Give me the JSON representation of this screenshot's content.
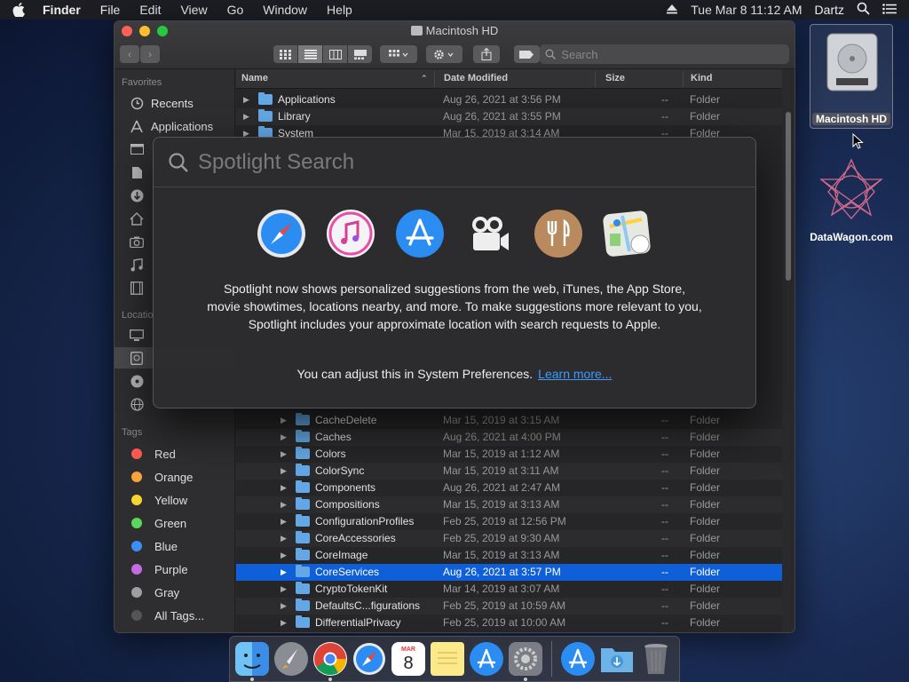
{
  "menubar": {
    "items": [
      "Finder",
      "File",
      "Edit",
      "View",
      "Go",
      "Window",
      "Help"
    ],
    "datetime": "Tue Mar 8  11:12 AM",
    "user": "Dartz"
  },
  "window": {
    "title": "Macintosh HD",
    "search_placeholder": "Search"
  },
  "sidebar": {
    "favorites_heading": "Favorites",
    "favorites": [
      {
        "label": "Recents",
        "icon": "clock-icon"
      },
      {
        "label": "Applications",
        "icon": "applications-icon"
      }
    ],
    "locations_heading": "Locatio",
    "tags_heading": "Tags",
    "tags": [
      {
        "label": "Red",
        "color": "#ff5a52"
      },
      {
        "label": "Orange",
        "color": "#f7a23b"
      },
      {
        "label": "Yellow",
        "color": "#f5d531"
      },
      {
        "label": "Green",
        "color": "#5ad85b"
      },
      {
        "label": "Blue",
        "color": "#3e8ef7"
      },
      {
        "label": "Purple",
        "color": "#c36be0"
      },
      {
        "label": "Gray",
        "color": "#9e9ea2"
      },
      {
        "label": "All Tags...",
        "color": "#555555"
      }
    ]
  },
  "list": {
    "headers": {
      "name": "Name",
      "date": "Date Modified",
      "size": "Size",
      "kind": "Kind"
    },
    "top_rows": [
      {
        "name": "Applications",
        "date": "Aug 26, 2021 at 3:56 PM",
        "size": "--",
        "kind": "Folder"
      },
      {
        "name": "Library",
        "date": "Aug 26, 2021 at 3:55 PM",
        "size": "--",
        "kind": "Folder"
      },
      {
        "name": "System",
        "date": "Mar 15, 2019 at 3:14 AM",
        "size": "--",
        "kind": "Folder"
      }
    ],
    "rows": [
      {
        "name": "CacheDelete",
        "date": "Mar 15, 2019 at 3:15 AM",
        "size": "--",
        "kind": "Folder"
      },
      {
        "name": "Caches",
        "date": "Aug 26, 2021 at 4:00 PM",
        "size": "--",
        "kind": "Folder"
      },
      {
        "name": "Colors",
        "date": "Mar 15, 2019 at 1:12 AM",
        "size": "--",
        "kind": "Folder"
      },
      {
        "name": "ColorSync",
        "date": "Mar 15, 2019 at 3:11 AM",
        "size": "--",
        "kind": "Folder"
      },
      {
        "name": "Components",
        "date": "Aug 26, 2021 at 2:47 AM",
        "size": "--",
        "kind": "Folder"
      },
      {
        "name": "Compositions",
        "date": "Mar 15, 2019 at 3:13 AM",
        "size": "--",
        "kind": "Folder"
      },
      {
        "name": "ConfigurationProfiles",
        "date": "Feb 25, 2019 at 12:56 PM",
        "size": "--",
        "kind": "Folder"
      },
      {
        "name": "CoreAccessories",
        "date": "Feb 25, 2019 at 9:30 AM",
        "size": "--",
        "kind": "Folder"
      },
      {
        "name": "CoreImage",
        "date": "Mar 15, 2019 at 3:13 AM",
        "size": "--",
        "kind": "Folder"
      },
      {
        "name": "CoreServices",
        "date": "Aug 26, 2021 at 3:57 PM",
        "size": "--",
        "kind": "Folder",
        "selected": true
      },
      {
        "name": "CryptoTokenKit",
        "date": "Mar 14, 2019 at 3:07 AM",
        "size": "--",
        "kind": "Folder"
      },
      {
        "name": "DefaultsC...figurations",
        "date": "Feb 25, 2019 at 10:59 AM",
        "size": "--",
        "kind": "Folder"
      },
      {
        "name": "DifferentialPrivacy",
        "date": "Feb 25, 2019 at 10:00 AM",
        "size": "--",
        "kind": "Folder"
      }
    ]
  },
  "spotlight": {
    "placeholder": "Spotlight Search",
    "icons": [
      "safari-icon",
      "itunes-icon",
      "app-store-icon",
      "movie-camera-icon",
      "restaurant-icon",
      "maps-icon"
    ],
    "message": "Spotlight now shows personalized suggestions from the web, iTunes, the App Store, movie showtimes, locations nearby, and more. To make suggestions more relevant to you, Spotlight includes your approximate location with search requests to Apple.",
    "adjust_text": "You can adjust this in System Preferences.",
    "learn_more": "Learn more..."
  },
  "desktop": {
    "hd_label": "Macintosh HD",
    "datawagon_label": "DataWagon.com"
  },
  "dock": {
    "apps": [
      "finder-icon",
      "launchpad-icon",
      "chrome-icon",
      "safari-icon",
      "calendar-icon",
      "notes-icon",
      "app-store-icon",
      "system-preferences-icon",
      "app-store-folder-icon",
      "downloads-folder-icon",
      "trash-icon"
    ],
    "calendar_month": "MAR",
    "calendar_day": "8"
  }
}
